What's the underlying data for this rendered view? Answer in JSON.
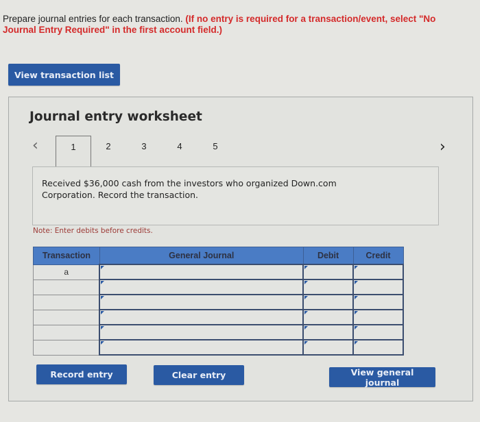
{
  "instructions": {
    "text": "Prepare journal entries for each transaction.",
    "warning": "(If no entry is required for a transaction/event, select \"No Journal Entry Required\" in the first account field.)"
  },
  "buttons": {
    "view_transaction_list": "View transaction list",
    "record_entry": "Record entry",
    "clear_entry": "Clear entry",
    "view_general_journal": "View general journal"
  },
  "worksheet": {
    "title": "Journal entry worksheet",
    "nav_prev": "‹",
    "nav_next": "›",
    "tabs": [
      "1",
      "2",
      "3",
      "4",
      "5"
    ],
    "active_tab": "1",
    "description": "Received $36,000 cash from the investors who organized Down.com Corporation. Record the transaction.",
    "note": "Note: Enter debits before credits."
  },
  "journal": {
    "headers": [
      "Transaction",
      "General Journal",
      "Debit",
      "Credit"
    ],
    "rows": [
      {
        "transaction": "a",
        "account": "",
        "debit": "",
        "credit": ""
      },
      {
        "transaction": "",
        "account": "",
        "debit": "",
        "credit": ""
      },
      {
        "transaction": "",
        "account": "",
        "debit": "",
        "credit": ""
      },
      {
        "transaction": "",
        "account": "",
        "debit": "",
        "credit": ""
      },
      {
        "transaction": "",
        "account": "",
        "debit": "",
        "credit": ""
      },
      {
        "transaction": "",
        "account": "",
        "debit": "",
        "credit": ""
      }
    ]
  },
  "colors": {
    "button_blue": "#2a5aa3",
    "header_blue": "#4a7cc5",
    "warning_red": "#d42a2a",
    "note_red": "#9c3a36"
  }
}
